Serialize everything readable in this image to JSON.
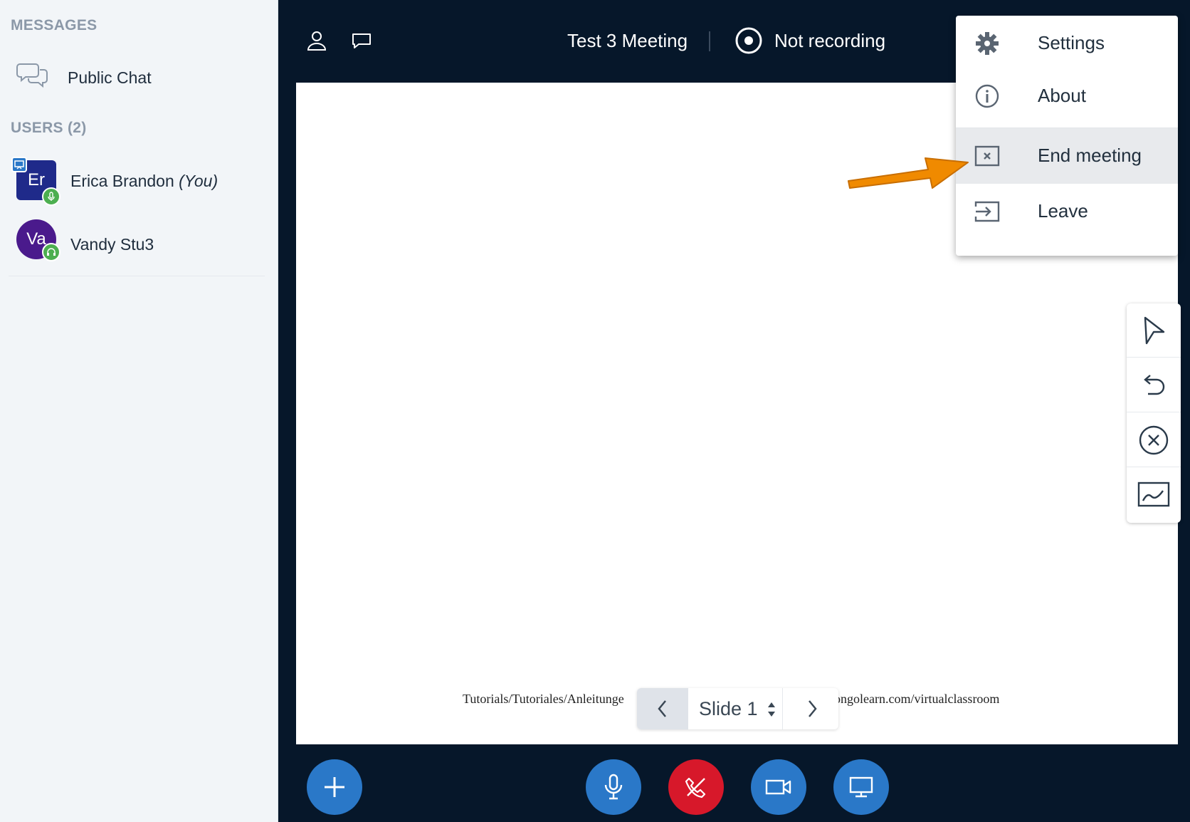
{
  "sidebar": {
    "messages_title": "MESSAGES",
    "public_chat_label": "Public Chat",
    "users_title": "USERS (2)",
    "users": [
      {
        "initials": "Er",
        "name": "Erica Brandon",
        "suffix": "(You)",
        "status": "microphone",
        "presenter": true,
        "avatar_color": "#1f2a8a"
      },
      {
        "initials": "Va",
        "name": "Vandy Stu3",
        "suffix": "",
        "status": "headphones",
        "presenter": false,
        "avatar_color": "#4a1a8c"
      }
    ]
  },
  "header": {
    "meeting_title": "Test 3 Meeting",
    "recording_label": "Not recording",
    "icons": [
      "user-icon",
      "chat-icon",
      "record-icon"
    ]
  },
  "options_menu": {
    "items": [
      {
        "label": "Settings",
        "icon": "gear-icon",
        "active": false
      },
      {
        "label": "About",
        "icon": "info-icon",
        "active": false
      },
      {
        "label": "End meeting",
        "icon": "close-box-icon",
        "active": true
      },
      {
        "label": "Leave",
        "icon": "exit-icon",
        "active": false
      }
    ]
  },
  "presentation": {
    "footer_left": "Tutorials/Tutoriales/Anleitunge",
    "footer_right": "ongolearn.com/virtualclassroom",
    "slide_label": "Slide 1"
  },
  "tools": [
    "pointer-icon",
    "undo-icon",
    "clear-icon",
    "whiteboard-icon"
  ],
  "actions": [
    "plus-icon",
    "microphone-icon",
    "hangup-icon",
    "video-icon",
    "screenshare-icon"
  ],
  "colors": {
    "background": "#06172a",
    "accent_blue": "#2a78c8",
    "hangup_red": "#d7182a",
    "annotation_orange": "#f08a00",
    "status_green": "#4caf50"
  }
}
